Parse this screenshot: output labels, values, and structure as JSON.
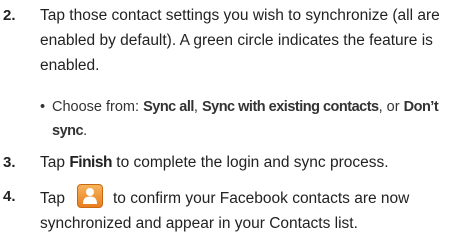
{
  "steps": [
    {
      "number": "2.",
      "text": "Tap those contact settings you wish to synchronize (all are enabled by default). A green circle indicates the feature is enabled."
    },
    {
      "number": "3.",
      "pre": "Tap ",
      "bold": "Finish",
      "post": "  to complete the login and sync process."
    },
    {
      "number": "4.",
      "pre": "Tap",
      "post": "to confirm your Facebook contacts are now synchronized and appear in your Contacts list.",
      "icon": "contacts-icon"
    }
  ],
  "bullet": {
    "marker": "•",
    "intro": "Choose from: ",
    "opt1": "Sync all",
    "sep1": ", ",
    "opt2": "Sync with existing contacts",
    "sep2": ", or ",
    "opt3": "Don’t sync",
    "end": "."
  }
}
